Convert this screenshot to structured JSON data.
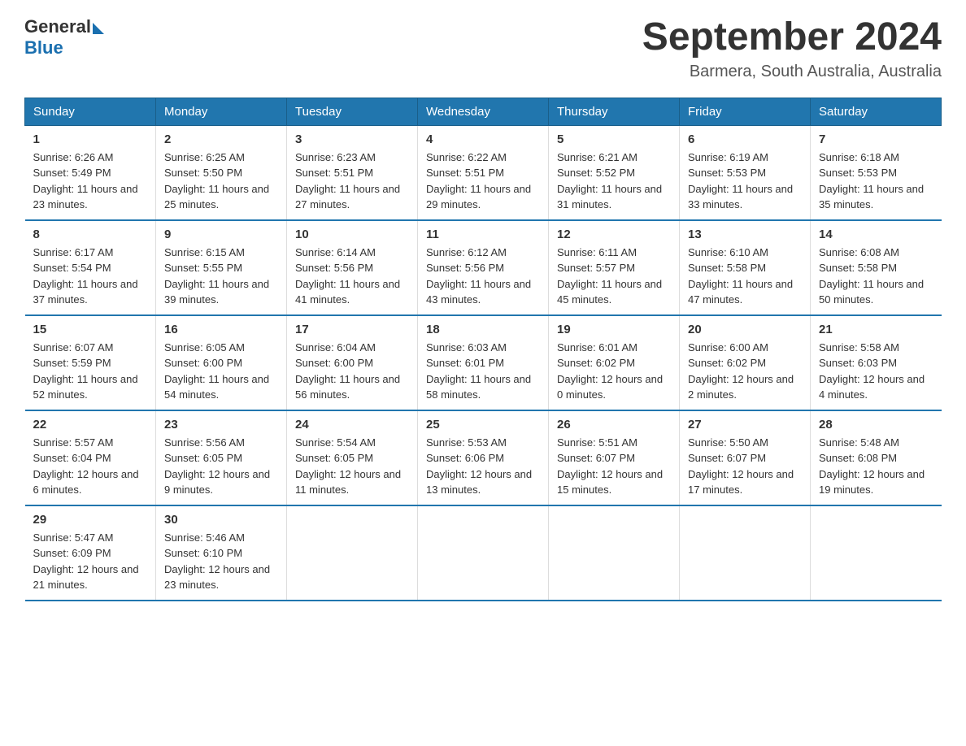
{
  "header": {
    "logo_general": "General",
    "logo_blue": "Blue",
    "month_title": "September 2024",
    "location": "Barmera, South Australia, Australia"
  },
  "calendar": {
    "days_of_week": [
      "Sunday",
      "Monday",
      "Tuesday",
      "Wednesday",
      "Thursday",
      "Friday",
      "Saturday"
    ],
    "weeks": [
      [
        {
          "day": "1",
          "sunrise": "6:26 AM",
          "sunset": "5:49 PM",
          "daylight": "11 hours and 23 minutes."
        },
        {
          "day": "2",
          "sunrise": "6:25 AM",
          "sunset": "5:50 PM",
          "daylight": "11 hours and 25 minutes."
        },
        {
          "day": "3",
          "sunrise": "6:23 AM",
          "sunset": "5:51 PM",
          "daylight": "11 hours and 27 minutes."
        },
        {
          "day": "4",
          "sunrise": "6:22 AM",
          "sunset": "5:51 PM",
          "daylight": "11 hours and 29 minutes."
        },
        {
          "day": "5",
          "sunrise": "6:21 AM",
          "sunset": "5:52 PM",
          "daylight": "11 hours and 31 minutes."
        },
        {
          "day": "6",
          "sunrise": "6:19 AM",
          "sunset": "5:53 PM",
          "daylight": "11 hours and 33 minutes."
        },
        {
          "day": "7",
          "sunrise": "6:18 AM",
          "sunset": "5:53 PM",
          "daylight": "11 hours and 35 minutes."
        }
      ],
      [
        {
          "day": "8",
          "sunrise": "6:17 AM",
          "sunset": "5:54 PM",
          "daylight": "11 hours and 37 minutes."
        },
        {
          "day": "9",
          "sunrise": "6:15 AM",
          "sunset": "5:55 PM",
          "daylight": "11 hours and 39 minutes."
        },
        {
          "day": "10",
          "sunrise": "6:14 AM",
          "sunset": "5:56 PM",
          "daylight": "11 hours and 41 minutes."
        },
        {
          "day": "11",
          "sunrise": "6:12 AM",
          "sunset": "5:56 PM",
          "daylight": "11 hours and 43 minutes."
        },
        {
          "day": "12",
          "sunrise": "6:11 AM",
          "sunset": "5:57 PM",
          "daylight": "11 hours and 45 minutes."
        },
        {
          "day": "13",
          "sunrise": "6:10 AM",
          "sunset": "5:58 PM",
          "daylight": "11 hours and 47 minutes."
        },
        {
          "day": "14",
          "sunrise": "6:08 AM",
          "sunset": "5:58 PM",
          "daylight": "11 hours and 50 minutes."
        }
      ],
      [
        {
          "day": "15",
          "sunrise": "6:07 AM",
          "sunset": "5:59 PM",
          "daylight": "11 hours and 52 minutes."
        },
        {
          "day": "16",
          "sunrise": "6:05 AM",
          "sunset": "6:00 PM",
          "daylight": "11 hours and 54 minutes."
        },
        {
          "day": "17",
          "sunrise": "6:04 AM",
          "sunset": "6:00 PM",
          "daylight": "11 hours and 56 minutes."
        },
        {
          "day": "18",
          "sunrise": "6:03 AM",
          "sunset": "6:01 PM",
          "daylight": "11 hours and 58 minutes."
        },
        {
          "day": "19",
          "sunrise": "6:01 AM",
          "sunset": "6:02 PM",
          "daylight": "12 hours and 0 minutes."
        },
        {
          "day": "20",
          "sunrise": "6:00 AM",
          "sunset": "6:02 PM",
          "daylight": "12 hours and 2 minutes."
        },
        {
          "day": "21",
          "sunrise": "5:58 AM",
          "sunset": "6:03 PM",
          "daylight": "12 hours and 4 minutes."
        }
      ],
      [
        {
          "day": "22",
          "sunrise": "5:57 AM",
          "sunset": "6:04 PM",
          "daylight": "12 hours and 6 minutes."
        },
        {
          "day": "23",
          "sunrise": "5:56 AM",
          "sunset": "6:05 PM",
          "daylight": "12 hours and 9 minutes."
        },
        {
          "day": "24",
          "sunrise": "5:54 AM",
          "sunset": "6:05 PM",
          "daylight": "12 hours and 11 minutes."
        },
        {
          "day": "25",
          "sunrise": "5:53 AM",
          "sunset": "6:06 PM",
          "daylight": "12 hours and 13 minutes."
        },
        {
          "day": "26",
          "sunrise": "5:51 AM",
          "sunset": "6:07 PM",
          "daylight": "12 hours and 15 minutes."
        },
        {
          "day": "27",
          "sunrise": "5:50 AM",
          "sunset": "6:07 PM",
          "daylight": "12 hours and 17 minutes."
        },
        {
          "day": "28",
          "sunrise": "5:48 AM",
          "sunset": "6:08 PM",
          "daylight": "12 hours and 19 minutes."
        }
      ],
      [
        {
          "day": "29",
          "sunrise": "5:47 AM",
          "sunset": "6:09 PM",
          "daylight": "12 hours and 21 minutes."
        },
        {
          "day": "30",
          "sunrise": "5:46 AM",
          "sunset": "6:10 PM",
          "daylight": "12 hours and 23 minutes."
        },
        null,
        null,
        null,
        null,
        null
      ]
    ]
  }
}
